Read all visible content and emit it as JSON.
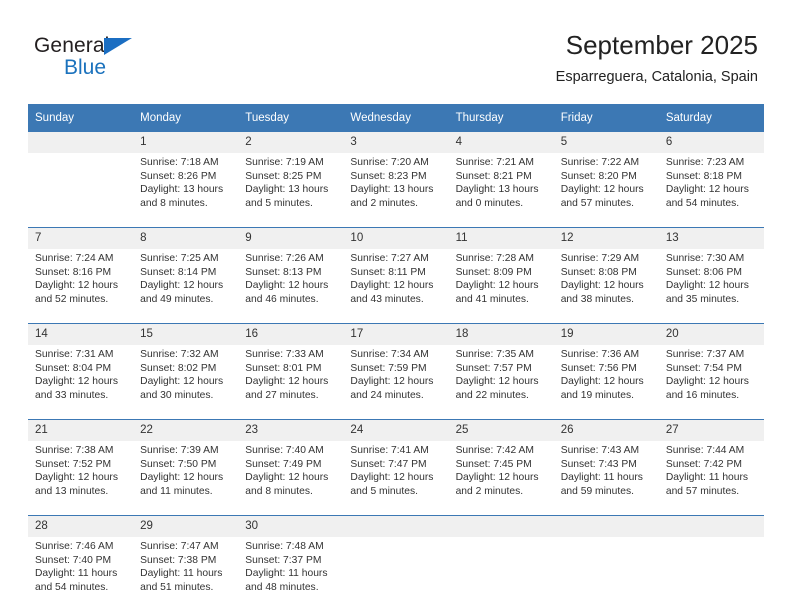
{
  "brand": {
    "word1": "General",
    "word2": "Blue",
    "triangle_color": "#1b6ec2",
    "blue_text_color": "#1b72bd"
  },
  "header": {
    "month_title": "September 2025",
    "location": "Esparreguera, Catalonia, Spain",
    "header_bg": "#3c78b4",
    "daynum_bg": "#f0f0f0"
  },
  "weekdays": [
    "Sunday",
    "Monday",
    "Tuesday",
    "Wednesday",
    "Thursday",
    "Friday",
    "Saturday"
  ],
  "weeks": [
    [
      {
        "day": "",
        "l1": "",
        "l2": "",
        "l3": "",
        "l4": ""
      },
      {
        "day": "1",
        "l1": "Sunrise: 7:18 AM",
        "l2": "Sunset: 8:26 PM",
        "l3": "Daylight: 13 hours",
        "l4": "and 8 minutes."
      },
      {
        "day": "2",
        "l1": "Sunrise: 7:19 AM",
        "l2": "Sunset: 8:25 PM",
        "l3": "Daylight: 13 hours",
        "l4": "and 5 minutes."
      },
      {
        "day": "3",
        "l1": "Sunrise: 7:20 AM",
        "l2": "Sunset: 8:23 PM",
        "l3": "Daylight: 13 hours",
        "l4": "and 2 minutes."
      },
      {
        "day": "4",
        "l1": "Sunrise: 7:21 AM",
        "l2": "Sunset: 8:21 PM",
        "l3": "Daylight: 13 hours",
        "l4": "and 0 minutes."
      },
      {
        "day": "5",
        "l1": "Sunrise: 7:22 AM",
        "l2": "Sunset: 8:20 PM",
        "l3": "Daylight: 12 hours",
        "l4": "and 57 minutes."
      },
      {
        "day": "6",
        "l1": "Sunrise: 7:23 AM",
        "l2": "Sunset: 8:18 PM",
        "l3": "Daylight: 12 hours",
        "l4": "and 54 minutes."
      }
    ],
    [
      {
        "day": "7",
        "l1": "Sunrise: 7:24 AM",
        "l2": "Sunset: 8:16 PM",
        "l3": "Daylight: 12 hours",
        "l4": "and 52 minutes."
      },
      {
        "day": "8",
        "l1": "Sunrise: 7:25 AM",
        "l2": "Sunset: 8:14 PM",
        "l3": "Daylight: 12 hours",
        "l4": "and 49 minutes."
      },
      {
        "day": "9",
        "l1": "Sunrise: 7:26 AM",
        "l2": "Sunset: 8:13 PM",
        "l3": "Daylight: 12 hours",
        "l4": "and 46 minutes."
      },
      {
        "day": "10",
        "l1": "Sunrise: 7:27 AM",
        "l2": "Sunset: 8:11 PM",
        "l3": "Daylight: 12 hours",
        "l4": "and 43 minutes."
      },
      {
        "day": "11",
        "l1": "Sunrise: 7:28 AM",
        "l2": "Sunset: 8:09 PM",
        "l3": "Daylight: 12 hours",
        "l4": "and 41 minutes."
      },
      {
        "day": "12",
        "l1": "Sunrise: 7:29 AM",
        "l2": "Sunset: 8:08 PM",
        "l3": "Daylight: 12 hours",
        "l4": "and 38 minutes."
      },
      {
        "day": "13",
        "l1": "Sunrise: 7:30 AM",
        "l2": "Sunset: 8:06 PM",
        "l3": "Daylight: 12 hours",
        "l4": "and 35 minutes."
      }
    ],
    [
      {
        "day": "14",
        "l1": "Sunrise: 7:31 AM",
        "l2": "Sunset: 8:04 PM",
        "l3": "Daylight: 12 hours",
        "l4": "and 33 minutes."
      },
      {
        "day": "15",
        "l1": "Sunrise: 7:32 AM",
        "l2": "Sunset: 8:02 PM",
        "l3": "Daylight: 12 hours",
        "l4": "and 30 minutes."
      },
      {
        "day": "16",
        "l1": "Sunrise: 7:33 AM",
        "l2": "Sunset: 8:01 PM",
        "l3": "Daylight: 12 hours",
        "l4": "and 27 minutes."
      },
      {
        "day": "17",
        "l1": "Sunrise: 7:34 AM",
        "l2": "Sunset: 7:59 PM",
        "l3": "Daylight: 12 hours",
        "l4": "and 24 minutes."
      },
      {
        "day": "18",
        "l1": "Sunrise: 7:35 AM",
        "l2": "Sunset: 7:57 PM",
        "l3": "Daylight: 12 hours",
        "l4": "and 22 minutes."
      },
      {
        "day": "19",
        "l1": "Sunrise: 7:36 AM",
        "l2": "Sunset: 7:56 PM",
        "l3": "Daylight: 12 hours",
        "l4": "and 19 minutes."
      },
      {
        "day": "20",
        "l1": "Sunrise: 7:37 AM",
        "l2": "Sunset: 7:54 PM",
        "l3": "Daylight: 12 hours",
        "l4": "and 16 minutes."
      }
    ],
    [
      {
        "day": "21",
        "l1": "Sunrise: 7:38 AM",
        "l2": "Sunset: 7:52 PM",
        "l3": "Daylight: 12 hours",
        "l4": "and 13 minutes."
      },
      {
        "day": "22",
        "l1": "Sunrise: 7:39 AM",
        "l2": "Sunset: 7:50 PM",
        "l3": "Daylight: 12 hours",
        "l4": "and 11 minutes."
      },
      {
        "day": "23",
        "l1": "Sunrise: 7:40 AM",
        "l2": "Sunset: 7:49 PM",
        "l3": "Daylight: 12 hours",
        "l4": "and 8 minutes."
      },
      {
        "day": "24",
        "l1": "Sunrise: 7:41 AM",
        "l2": "Sunset: 7:47 PM",
        "l3": "Daylight: 12 hours",
        "l4": "and 5 minutes."
      },
      {
        "day": "25",
        "l1": "Sunrise: 7:42 AM",
        "l2": "Sunset: 7:45 PM",
        "l3": "Daylight: 12 hours",
        "l4": "and 2 minutes."
      },
      {
        "day": "26",
        "l1": "Sunrise: 7:43 AM",
        "l2": "Sunset: 7:43 PM",
        "l3": "Daylight: 11 hours",
        "l4": "and 59 minutes."
      },
      {
        "day": "27",
        "l1": "Sunrise: 7:44 AM",
        "l2": "Sunset: 7:42 PM",
        "l3": "Daylight: 11 hours",
        "l4": "and 57 minutes."
      }
    ],
    [
      {
        "day": "28",
        "l1": "Sunrise: 7:46 AM",
        "l2": "Sunset: 7:40 PM",
        "l3": "Daylight: 11 hours",
        "l4": "and 54 minutes."
      },
      {
        "day": "29",
        "l1": "Sunrise: 7:47 AM",
        "l2": "Sunset: 7:38 PM",
        "l3": "Daylight: 11 hours",
        "l4": "and 51 minutes."
      },
      {
        "day": "30",
        "l1": "Sunrise: 7:48 AM",
        "l2": "Sunset: 7:37 PM",
        "l3": "Daylight: 11 hours",
        "l4": "and 48 minutes."
      },
      {
        "day": "",
        "l1": "",
        "l2": "",
        "l3": "",
        "l4": ""
      },
      {
        "day": "",
        "l1": "",
        "l2": "",
        "l3": "",
        "l4": ""
      },
      {
        "day": "",
        "l1": "",
        "l2": "",
        "l3": "",
        "l4": ""
      },
      {
        "day": "",
        "l1": "",
        "l2": "",
        "l3": "",
        "l4": ""
      }
    ]
  ]
}
